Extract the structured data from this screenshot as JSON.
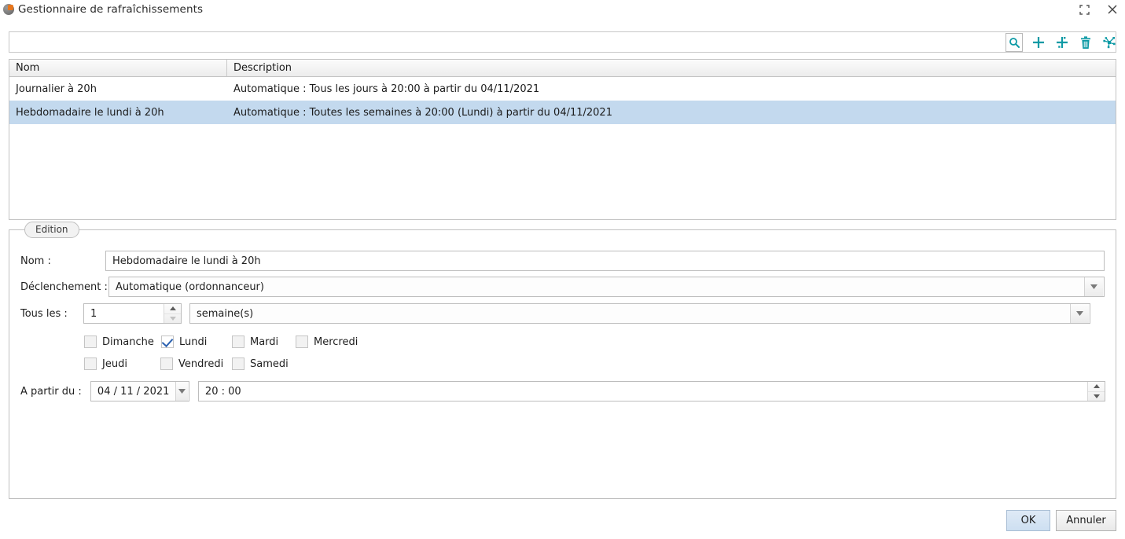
{
  "window": {
    "title": "Gestionnaire de rafraîchissements",
    "icon": "app-sphere-icon",
    "maximize_label": "Agrandir",
    "close_label": "Fermer"
  },
  "search": {
    "value": "",
    "placeholder": ""
  },
  "toolbar": {
    "items": [
      {
        "name": "search-icon",
        "label": "Rechercher"
      },
      {
        "name": "add-icon",
        "label": "Ajouter"
      },
      {
        "name": "add-variant-icon",
        "label": "Ajouter (variante)"
      },
      {
        "name": "delete-icon",
        "label": "Supprimer"
      },
      {
        "name": "scatter-icon",
        "label": "Disperser"
      }
    ]
  },
  "table": {
    "columns": [
      "Nom",
      "Description"
    ],
    "rows": [
      {
        "nom": "Journalier à 20h",
        "description": "Automatique : Tous les jours à 20:00 à partir du 04/11/2021",
        "selected": false
      },
      {
        "nom": "Hebdomadaire le lundi à 20h",
        "description": "Automatique : Toutes les semaines à 20:00 (Lundi) à partir du 04/11/2021",
        "selected": true
      }
    ]
  },
  "edition": {
    "legend": "Edition",
    "nom_label": "Nom :",
    "nom_value": "Hebdomadaire le lundi à 20h",
    "declenchement_label": "Déclenchement :",
    "declenchement_value": "Automatique (ordonnanceur)",
    "tous_les_label": "Tous les :",
    "interval_value": "1",
    "unit_value": "semaine(s)",
    "days": [
      {
        "label": "Dimanche",
        "checked": false
      },
      {
        "label": "Lundi",
        "checked": true
      },
      {
        "label": "Mardi",
        "checked": false
      },
      {
        "label": "Mercredi",
        "checked": false
      },
      {
        "label": "Jeudi",
        "checked": false
      },
      {
        "label": "Vendredi",
        "checked": false
      },
      {
        "label": "Samedi",
        "checked": false
      }
    ],
    "apartir_label": "A partir du :",
    "date_value": "04 / 11 / 2021",
    "time_value": "20 : 00"
  },
  "footer": {
    "ok_label": "OK",
    "cancel_label": "Annuler"
  },
  "colors": {
    "accent_teal": "#0d9aa5",
    "selection_blue": "#c3d9ee",
    "check_blue": "#2d62b0",
    "icon_orange": "#e8761c"
  }
}
